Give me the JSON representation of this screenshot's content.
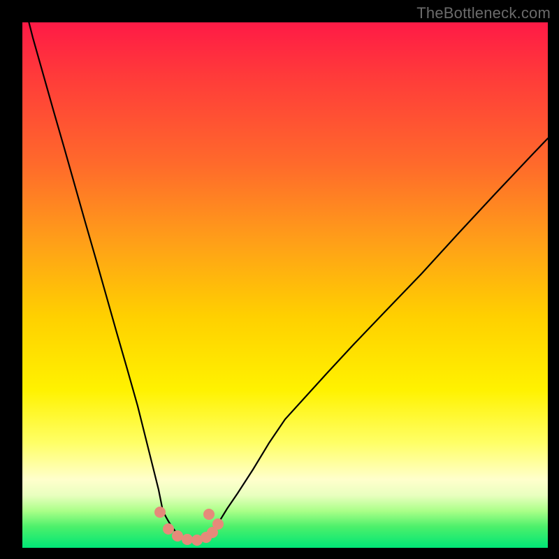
{
  "watermark": {
    "text": "TheBottleneck.com"
  },
  "chart_data": {
    "type": "line",
    "x": [
      0.0,
      0.02,
      0.04,
      0.06,
      0.08,
      0.1,
      0.12,
      0.14,
      0.16,
      0.18,
      0.2,
      0.22,
      0.24,
      0.26,
      0.2675,
      0.2725,
      0.28,
      0.29,
      0.3,
      0.31,
      0.32,
      0.33,
      0.345,
      0.36,
      0.375,
      0.39,
      0.41,
      0.44,
      0.47,
      0.5,
      0.54,
      0.58,
      0.63,
      0.69,
      0.76,
      0.83,
      0.9,
      0.97,
      1.0
    ],
    "values": [
      105,
      97,
      90,
      83,
      76,
      69,
      62,
      55,
      48,
      41,
      34,
      27,
      19,
      11,
      7,
      5.5,
      4.2,
      2.8,
      2.0,
      1.6,
      1.4,
      1.4,
      1.8,
      2.6,
      3.8,
      5.2,
      7.2,
      10.6,
      14.2,
      17.8,
      22.2,
      26.6,
      32.0,
      38.4,
      45.6,
      53.2,
      60.8,
      68.4,
      71.5
    ],
    "xlim": [
      0.0,
      1.0
    ],
    "ylim": [
      0.0,
      100.0
    ],
    "title": "",
    "xlabel": "",
    "ylabel": "",
    "markers": {
      "x": [
        0.262,
        0.278,
        0.296,
        0.314,
        0.332,
        0.35,
        0.362,
        0.372,
        0.355
      ],
      "y": [
        6.8,
        3.6,
        2.2,
        1.6,
        1.5,
        2.0,
        3.0,
        4.6,
        6.4
      ],
      "color": "#e68a7a",
      "radius_px": 8
    },
    "gradient_stops": [
      {
        "pos": 0.0,
        "color": "#ff1a46"
      },
      {
        "pos": 0.27,
        "color": "#ff6a2b"
      },
      {
        "pos": 0.56,
        "color": "#ffd000"
      },
      {
        "pos": 0.8,
        "color": "#ffff66"
      },
      {
        "pos": 0.93,
        "color": "#aaff88"
      },
      {
        "pos": 1.0,
        "color": "#00e676"
      }
    ]
  }
}
